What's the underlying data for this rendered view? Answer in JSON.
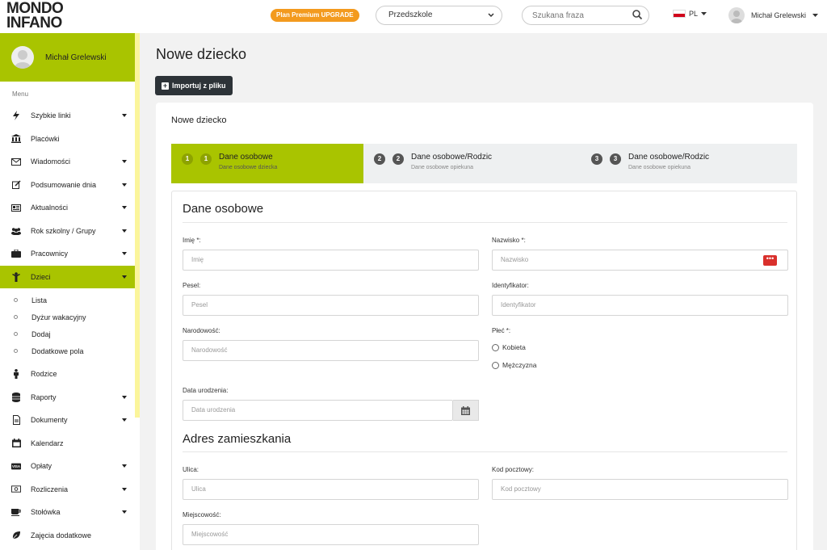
{
  "brand": {
    "line1": "MONDO",
    "line2": "INFANO",
    "accent": "#a9c400"
  },
  "topbar": {
    "premium_label": "Plan Premium UPGRADE",
    "institution_select": "Przedszkole",
    "search_placeholder": "Szukana fraza",
    "language": "PL",
    "user_name": "Michał Grelewski"
  },
  "sidebar": {
    "user_name": "Michał Grelewski",
    "menu_label": "Menu",
    "items": [
      {
        "label": "Szybkie linki",
        "icon": "bolt-icon",
        "caret": true
      },
      {
        "label": "Placówki",
        "icon": "building-icon",
        "caret": false
      },
      {
        "label": "Wiadomości",
        "icon": "envelope-icon",
        "caret": true
      },
      {
        "label": "Podsumowanie dnia",
        "icon": "edit-icon",
        "caret": true
      },
      {
        "label": "Aktualności",
        "icon": "newspaper-icon",
        "caret": true
      },
      {
        "label": "Rok szkolny / Grupy",
        "icon": "users-icon",
        "caret": true
      },
      {
        "label": "Pracownicy",
        "icon": "briefcase-icon",
        "caret": true
      },
      {
        "label": "Dzieci",
        "icon": "child-icon",
        "caret": true,
        "active": true
      }
    ],
    "submenu": [
      "Lista",
      "Dyżur wakacyjny",
      "Dodaj",
      "Dodatkowe pola"
    ],
    "items_after": [
      {
        "label": "Rodzice",
        "icon": "person-icon",
        "caret": false
      },
      {
        "label": "Raporty",
        "icon": "database-icon",
        "caret": true
      },
      {
        "label": "Dokumenty",
        "icon": "file-icon",
        "caret": true
      },
      {
        "label": "Kalendarz",
        "icon": "calendar-icon",
        "caret": false
      },
      {
        "label": "Opłaty",
        "icon": "visa-icon",
        "caret": true
      },
      {
        "label": "Rozliczenia",
        "icon": "money-icon",
        "caret": true
      },
      {
        "label": "Stołówka",
        "icon": "cup-icon",
        "caret": true
      },
      {
        "label": "Zajęcia dodatkowe",
        "icon": "leaf-icon",
        "caret": false
      }
    ]
  },
  "main": {
    "page_title": "Nowe dziecko",
    "import_button": "Importuj z pliku",
    "card_title": "Nowe dziecko",
    "steps": [
      {
        "num": "1",
        "title": "Dane osobowe",
        "subtitle": "Dane osobowe dziecka"
      },
      {
        "num": "2",
        "title": "Dane osobowe/Rodzic",
        "subtitle": "Dane osobowe opiekuna"
      },
      {
        "num": "3",
        "title": "Dane osobowe/Rodzic",
        "subtitle": "Dane osobowe opiekuna"
      }
    ],
    "section_personal": "Dane osobowe",
    "fields": {
      "imie_label": "Imię *:",
      "imie_placeholder": "Imię",
      "nazwisko_label": "Nazwisko *:",
      "nazwisko_placeholder": "Nazwisko",
      "pesel_label": "Pesel:",
      "pesel_placeholder": "Pesel",
      "identyfikator_label": "Identyfikator:",
      "identyfikator_placeholder": "Identyfikator",
      "narodowosc_label": "Narodowość:",
      "narodowosc_placeholder": "Narodowość",
      "plec_label": "Płeć *:",
      "plec_female": "Kobieta",
      "plec_male": "Mężczyzna",
      "data_label": "Data urodzenia:",
      "data_placeholder": "Data urodzenia"
    },
    "section_address": "Adres zamieszkania",
    "address": {
      "ulica_label": "Ulica:",
      "ulica_placeholder": "Ulica",
      "kod_label": "Kod pocztowy:",
      "kod_placeholder": "Kod pocztowy",
      "miejscowosc_label": "Miejscowość:",
      "miejscowosc_placeholder": "Miejscowość"
    }
  }
}
